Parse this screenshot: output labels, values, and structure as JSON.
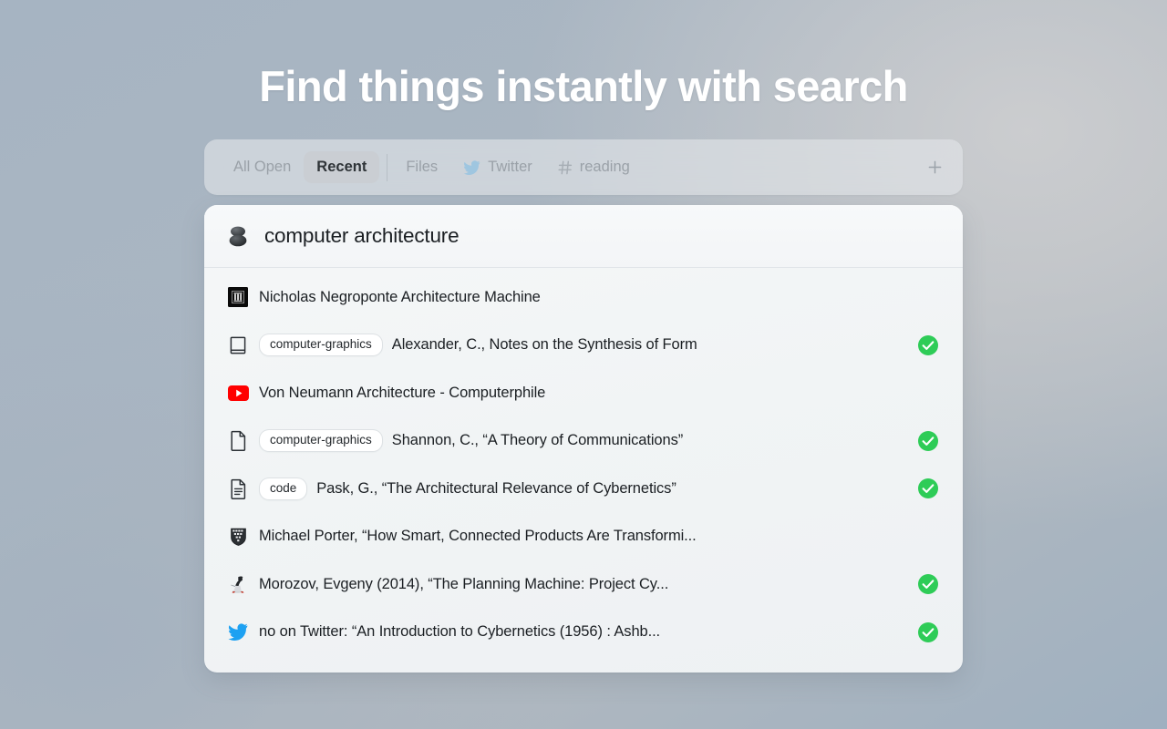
{
  "hero": {
    "title": "Find things instantly with search"
  },
  "tabbar": {
    "tabs": [
      {
        "label": "All Open",
        "icon": "",
        "active": false,
        "divider_after": false
      },
      {
        "label": "Recent",
        "icon": "",
        "active": true,
        "divider_after": true
      },
      {
        "label": "Files",
        "icon": "",
        "active": false,
        "divider_after": false
      },
      {
        "label": "Twitter",
        "icon": "twitter-icon",
        "active": false,
        "divider_after": false
      },
      {
        "label": "reading",
        "icon": "hash-icon",
        "active": false,
        "divider_after": false
      }
    ],
    "add_button": {
      "label": "+",
      "icon": "plus-icon"
    }
  },
  "card": {
    "header": {
      "icon": "stack-icon",
      "title": "computer architecture"
    },
    "rows": [
      {
        "icon": "mit-press-building-icon",
        "tag": "",
        "title": "Nicholas Negroponte Architecture Machine",
        "checked": false
      },
      {
        "icon": "book-icon",
        "tag": "computer-graphics",
        "title": "Alexander, C., Notes on the Synthesis of Form",
        "checked": true
      },
      {
        "icon": "youtube-icon",
        "tag": "",
        "title": "Von Neumann Architecture - Computerphile",
        "checked": false
      },
      {
        "icon": "file-icon",
        "tag": "computer-graphics",
        "title": "Shannon, C., “A Theory of Communications”",
        "checked": true
      },
      {
        "icon": "document-lines-icon",
        "tag": "code",
        "title": "Pask, G., “The Architectural Relevance of Cybernetics”",
        "checked": true
      },
      {
        "icon": "harvard-shield-icon",
        "tag": "",
        "title": "Michael Porter, “How Smart, Connected Products Are Transformi...",
        "checked": false
      },
      {
        "icon": "new-yorker-icon",
        "tag": "",
        "title": "Morozov, Evgeny (2014), “The Planning Machine: Project Cy...",
        "checked": true
      },
      {
        "icon": "twitter-icon",
        "tag": "",
        "title": "no on Twitter: “An Introduction to Cybernetics (1956) : Ashb...",
        "checked": true
      }
    ]
  },
  "colors": {
    "accent_green": "#2ecc57",
    "twitter_blue": "#1da1f2",
    "youtube_red": "#ff0000",
    "background_start": "#a6b4c2",
    "background_end": "#9fb0c0",
    "card_background": "#f2f4f5",
    "title_text": "#ffffff"
  }
}
